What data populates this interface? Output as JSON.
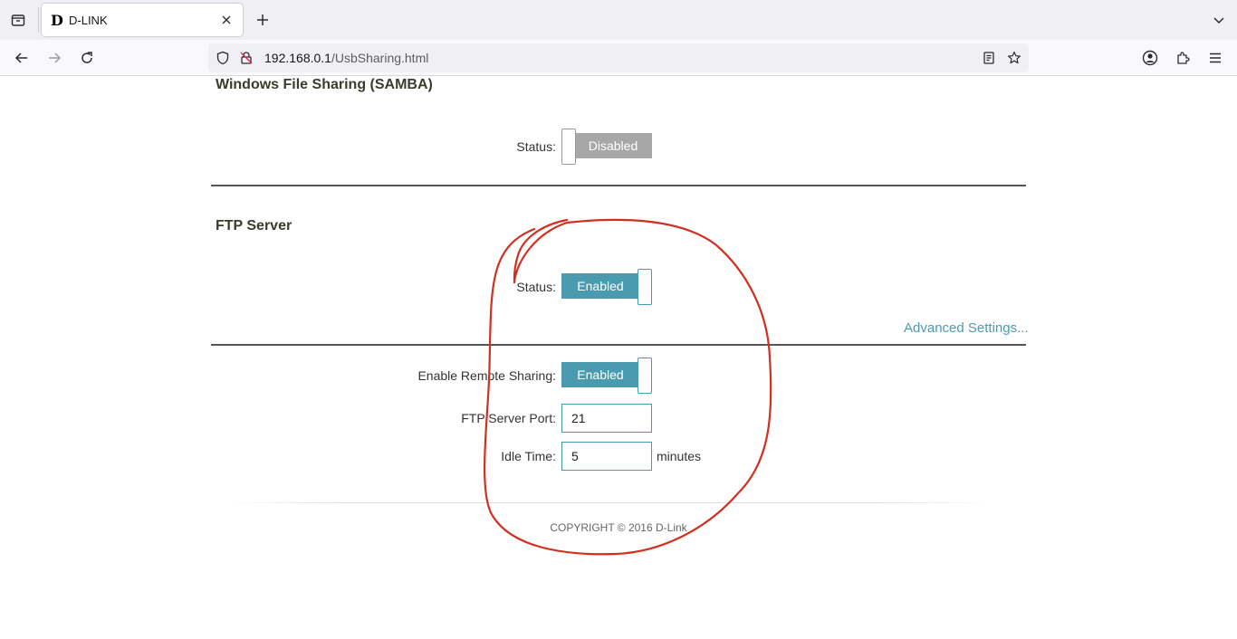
{
  "browser": {
    "tab_title": "D-LINK",
    "favicon_letter": "D",
    "url_host": "192.168.0.1",
    "url_path": "/UsbSharing.html"
  },
  "samba": {
    "title": "Windows File Sharing (SAMBA)",
    "status_label": "Status:",
    "status_value": "Disabled"
  },
  "ftp": {
    "title": "FTP Server",
    "status_label": "Status:",
    "status_value": "Enabled",
    "advanced_link": "Advanced Settings...",
    "remote_sharing_label": "Enable Remote Sharing:",
    "remote_sharing_value": "Enabled",
    "port_label": "FTP Server Port:",
    "port_value": "21",
    "idle_label": "Idle Time:",
    "idle_value": "5",
    "idle_unit": "minutes"
  },
  "footer": {
    "copyright": "COPYRIGHT © 2016 D-Link"
  },
  "annotation": {
    "color": "#d13020"
  }
}
